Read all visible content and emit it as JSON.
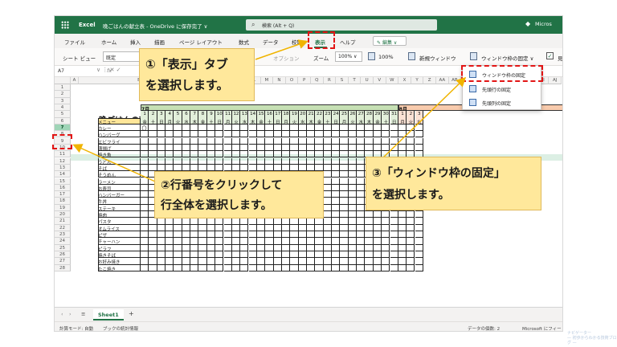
{
  "titlebar": {
    "app_name": "Excel",
    "doc_title": "晩ごはんの献立表 - OneDrive に保存完了 ∨",
    "search_placeholder": "検索 (Alt + Q)",
    "account": "Micros"
  },
  "menu": {
    "items": [
      "ファイル",
      "ホーム",
      "挿入",
      "描画",
      "ページ レイアウト",
      "数式",
      "データ",
      "校閲",
      "表示",
      "ヘルプ"
    ],
    "active": "表示",
    "edit_label": "編集 ∨"
  },
  "toolbar": {
    "sheet_view_label": "シート ビュー",
    "sheet_view_value": "既定",
    "options_label": "オプション",
    "zoom_label": "ズーム",
    "zoom_value": "100% ∨",
    "zoom_100": "100%",
    "new_window": "新規ウィンドウ",
    "freeze_panes": "ウィンドウ枠の固定 ∨",
    "trailing": "見"
  },
  "formula_bar": {
    "cell_ref": "A7",
    "separator": "∨ ⋮ ✕ ✓",
    "fx": "fx"
  },
  "grid": {
    "column_headers": [
      "A",
      "B",
      "L",
      "M",
      "N",
      "O",
      "P",
      "Q",
      "R",
      "S",
      "T",
      "U",
      "V",
      "W",
      "X",
      "Y",
      "Z",
      "AA",
      "AB",
      "AC",
      "AD",
      "AE",
      "AF",
      "AG",
      "AH",
      "AI",
      "AJ"
    ],
    "row_numbers": [
      "1",
      "2",
      "3",
      "4",
      "5",
      "6",
      "7",
      "8",
      "9",
      "10",
      "11",
      "12",
      "13",
      "14",
      "15",
      "16",
      "17",
      "18",
      "19",
      "20",
      "21",
      "22",
      "23",
      "24",
      "25",
      "26",
      "27",
      "28"
    ],
    "sheet_title": "晩ごはんの献立表",
    "month_july": "7月",
    "month_august": "8月",
    "menu_header": "メニュー",
    "menu_items": [
      "カレー",
      "ハンバーグ",
      "エビフライ",
      "唐揚げ",
      "焼き魚",
      "うどん",
      "そば",
      "そうめん",
      "ラーメン",
      "お寿司",
      "ハンバーガー",
      "牛丼",
      "ステーキ",
      "焼肉",
      "パスタ",
      "オムライス",
      "ピザ",
      "チャーハン",
      "ピラフ",
      "焼きそば",
      "お好み焼き",
      "たこ焼き"
    ],
    "july_days": [
      "1",
      "2",
      "3",
      "4",
      "5",
      "6",
      "7",
      "8",
      "9",
      "10",
      "11",
      "12",
      "13",
      "14",
      "15",
      "16",
      "17",
      "18",
      "19",
      "20",
      "21",
      "22",
      "23",
      "24",
      "25",
      "26",
      "27",
      "28",
      "29",
      "30",
      "31"
    ],
    "july_weekdays": [
      "金",
      "土",
      "日",
      "月",
      "火",
      "水",
      "木",
      "金",
      "土",
      "日",
      "月",
      "火",
      "水",
      "木",
      "金",
      "土",
      "日",
      "月",
      "火",
      "水",
      "木",
      "金",
      "土",
      "日",
      "月",
      "火",
      "水",
      "木",
      "金",
      "土",
      "日"
    ],
    "aug_days": [
      "1",
      "2",
      "3"
    ],
    "aug_weekdays": [
      "月",
      "火",
      "水"
    ],
    "marker": "〇"
  },
  "freeze_dropdown": {
    "items": [
      "ウィンドウ枠の固定",
      "先頭行の固定",
      "先頭列の固定"
    ]
  },
  "tabs": {
    "sheet": "Sheet1",
    "add": "+"
  },
  "status": {
    "calc_mode": "計算モード: 自動",
    "workbook_stats": "ブックの統計情報",
    "data_count": "データの個数: 2",
    "feedback": "Microsoft にフィー"
  },
  "annotations": {
    "step1_line1": "①「表示」タブ",
    "step1_line2": "を選択します。",
    "step2_line1": "②行番号をクリックして",
    "step2_line2": "行全体を選択します。",
    "step3_line1": "③「ウィンドウ枠の固定」",
    "step3_line2": "を選択します。"
  },
  "watermark": {
    "line1": "ナビゲーター",
    "line2": "— 初歩からわかる技術ブログ —"
  },
  "colors": {
    "excel_green": "#217346",
    "callout_fill": "#ffe89b",
    "highlight_dash": "#e21515",
    "arrow": "#f0b400",
    "july_header": "#c6e0b4",
    "august_header": "#f8cbad"
  }
}
